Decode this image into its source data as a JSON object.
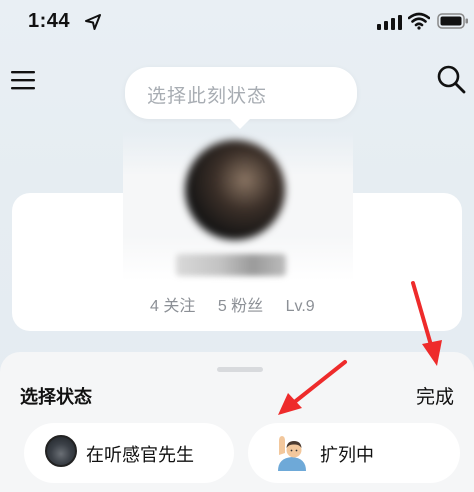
{
  "status_bar": {
    "time": "1:44",
    "icons": [
      "location-arrow-icon",
      "signal-icon",
      "wifi-icon",
      "battery-icon"
    ]
  },
  "header": {
    "menu_icon": "hamburger-menu-icon",
    "search_icon": "search-icon"
  },
  "status_bubble": {
    "placeholder": "选择此刻状态"
  },
  "profile": {
    "stats": {
      "following": "4 关注",
      "followers": "5 粉丝",
      "level": "Lv.9"
    }
  },
  "bottom_sheet": {
    "title": "选择状态",
    "done_label": "完成",
    "options": [
      {
        "label": "在听感官先生",
        "icon": "album-avatar"
      },
      {
        "label": "扩列中",
        "icon": "person-raising-hand-emoji"
      }
    ]
  },
  "colors": {
    "background": "#e7eef3",
    "card": "#ffffff",
    "sheet": "#f5f6f7",
    "muted_text": "#8c9096",
    "placeholder_text": "#a8adb3",
    "annotation_arrow": "#ee2b2b"
  }
}
